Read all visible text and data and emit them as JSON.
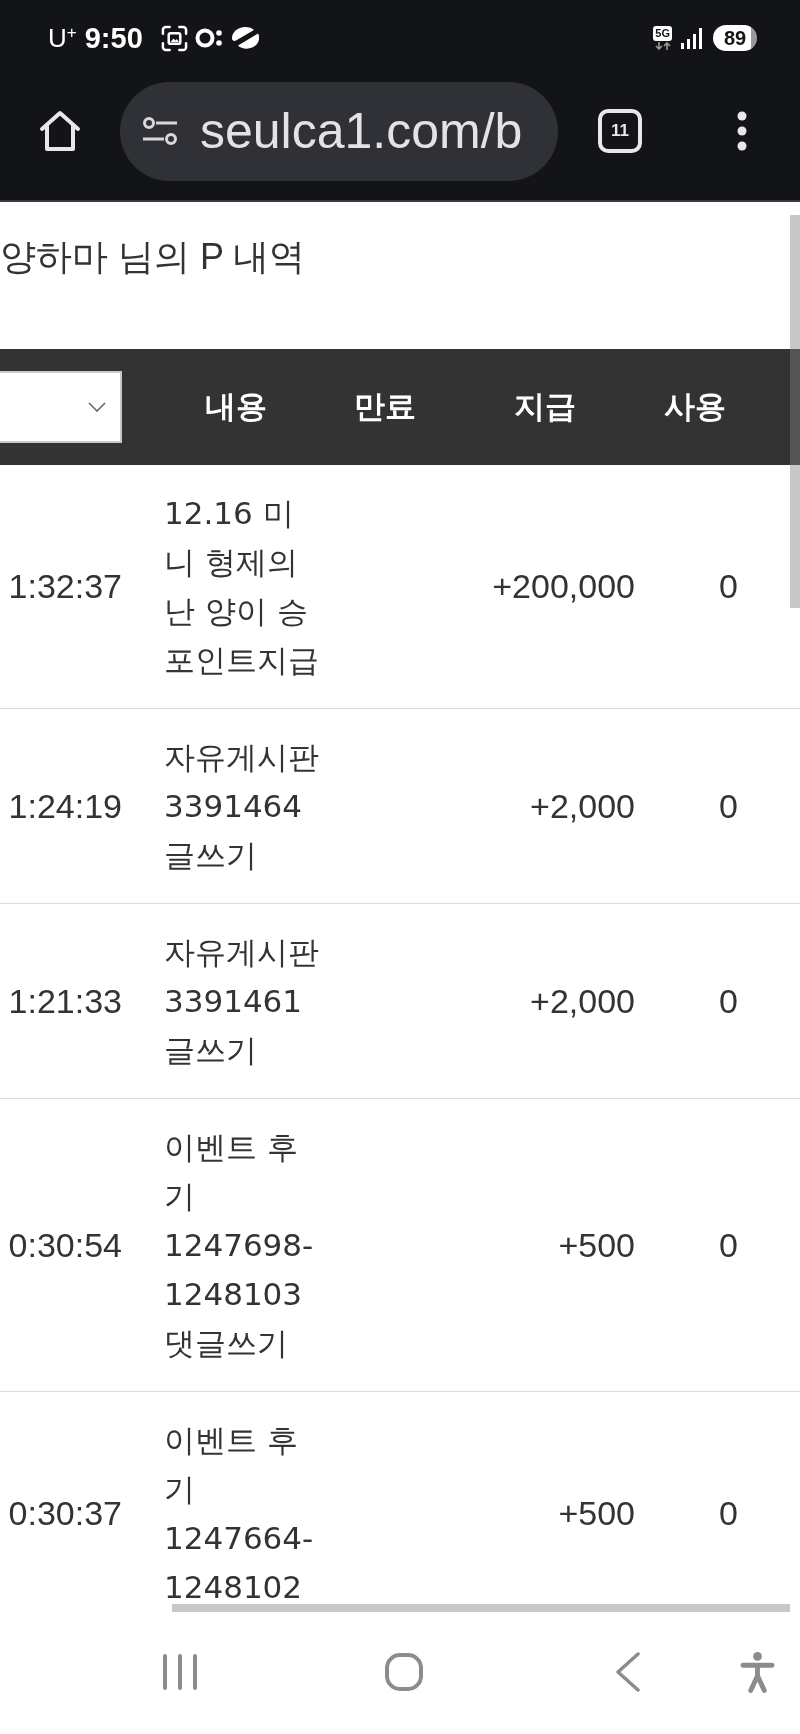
{
  "status_bar": {
    "carrier": "U$^{+}$",
    "time": "9:50",
    "network": "5G",
    "battery": "89"
  },
  "browser": {
    "url": "seulca1.com/b",
    "tab_count": "11"
  },
  "page": {
    "title": "양하마 님의 P 내역"
  },
  "table": {
    "columns": [
      "내용",
      "만료",
      "지급",
      "사용"
    ],
    "rows": [
      {
        "column_1": "1:32:37",
        "content": "12.16 미니 형제의 난 양이 승 포인트지급",
        "granted": "+200,000",
        "used": "0"
      },
      {
        "column_1": "1:24:19",
        "content": "자유게시판 3391464 글쓰기",
        "granted": "+2,000",
        "used": "0"
      },
      {
        "column_1": "1:21:33",
        "content": "자유게시판 3391461 글쓰기",
        "granted": "+2,000",
        "used": "0"
      },
      {
        "column_1": "0:30:54",
        "content": "이벤트 후기 1247698-1248103 댓글쓰기",
        "granted": "+500",
        "used": "0"
      },
      {
        "column_1": "0:30:37",
        "content": "이벤트 후기 1247664-1248102",
        "granted": "+500",
        "used": "0"
      }
    ]
  }
}
